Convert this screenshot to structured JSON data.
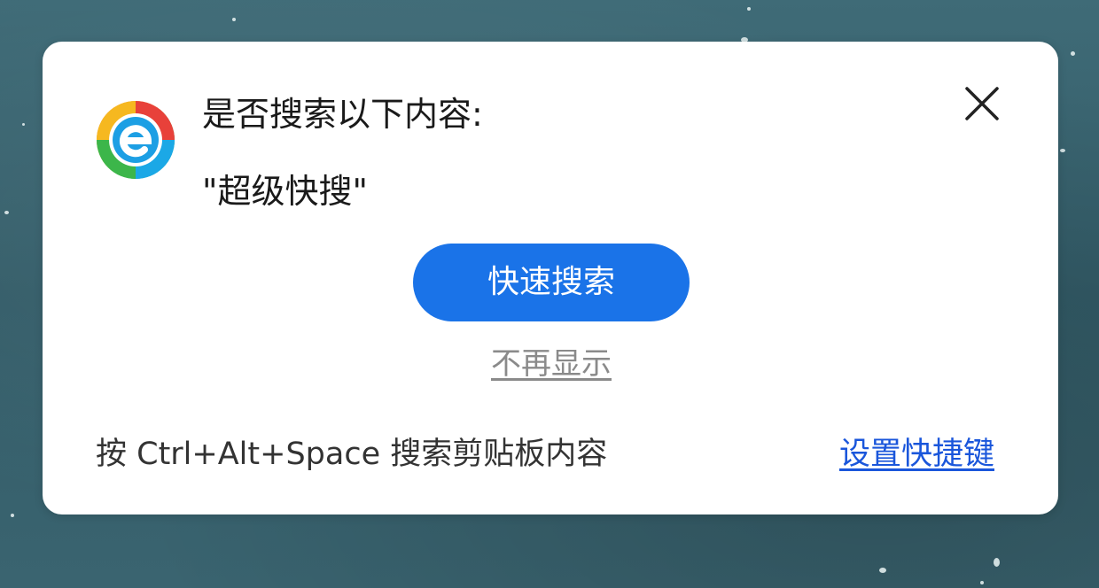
{
  "dialog": {
    "title": "是否搜索以下内容:",
    "query": "\"超级快搜\"",
    "primary_button_label": "快速搜索",
    "dismiss_label": "不再显示",
    "hint": "按 Ctrl+Alt+Space 搜索剪贴板内容",
    "settings_link_label": "设置快捷键",
    "close_icon": "close-icon",
    "logo_icon": "browser-logo-icon"
  },
  "colors": {
    "primary_button": "#1a73e8",
    "link": "#1a56db",
    "dismiss_text": "#8a8a8a",
    "backdrop": "#3a6470"
  }
}
